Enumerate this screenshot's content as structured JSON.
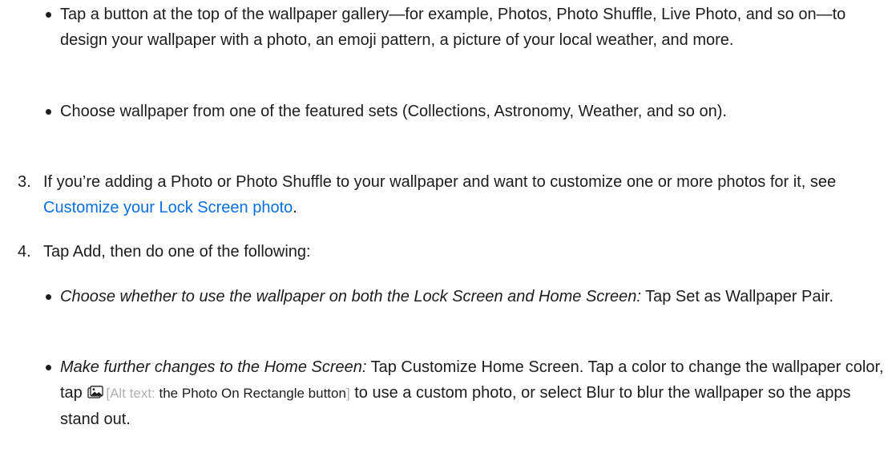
{
  "bullets_top": [
    {
      "text": "Tap a button at the top of the wallpaper gallery—for example, Photos, Photo Shuffle, Live Photo, and so on—to design your wallpaper with a photo, an emoji pattern, a picture of your local weather, and more."
    },
    {
      "text": "Choose wallpaper from one of the featured sets (Collections, Astronomy, Weather, and so on)."
    }
  ],
  "step3": {
    "number": "3.",
    "text_before": "If you’re adding a Photo or Photo Shuffle to your wallpaper and want to customize one or more photos for it, see ",
    "link": "Customize your Lock Screen photo",
    "text_after": "."
  },
  "step4": {
    "number": "4.",
    "text": "Tap Add, then do one of the following:"
  },
  "bullets_bottom": [
    {
      "italic": "Choose whether to use the wallpaper on both the Lock Screen and Home Screen:",
      "text": " Tap Set as Wallpaper Pair."
    },
    {
      "italic": "Make further changes to the Home Screen:",
      "text_before_icon": " Tap Customize Home Screen. Tap a color to change the wallpaper color, tap ",
      "icon_name": "photo-on-rectangle-icon",
      "alt_prefix": "[Alt text: ",
      "alt_text": "the Photo On Rectangle button",
      "alt_suffix": "]",
      "text_after_icon": " to use a custom photo, or select Blur to blur the wallpaper so the apps stand out."
    }
  ]
}
